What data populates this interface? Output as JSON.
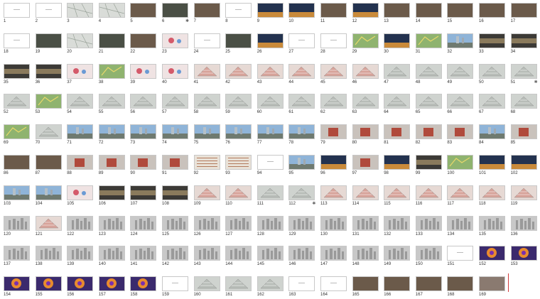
{
  "app": {
    "view": "slide-sorter-thumbnail-grid"
  },
  "slides": [
    {
      "n": "1",
      "v": "blank"
    },
    {
      "n": "2",
      "v": "blank"
    },
    {
      "n": "3",
      "v": "map"
    },
    {
      "n": "4",
      "v": "map"
    },
    {
      "n": "5",
      "v": "photo"
    },
    {
      "n": "6",
      "v": "aerial",
      "star": true
    },
    {
      "n": "7",
      "v": "photo"
    },
    {
      "n": "8",
      "v": "blank"
    },
    {
      "n": "9",
      "v": "night"
    },
    {
      "n": "10",
      "v": "night"
    },
    {
      "n": "11",
      "v": "photo"
    },
    {
      "n": "12",
      "v": "night"
    },
    {
      "n": "13",
      "v": "photo"
    },
    {
      "n": "14",
      "v": "photo"
    },
    {
      "n": "15",
      "v": "photo"
    },
    {
      "n": "16",
      "v": "photo"
    },
    {
      "n": "17",
      "v": "photo"
    },
    {
      "n": "18",
      "v": "blank"
    },
    {
      "n": "19",
      "v": "aerial"
    },
    {
      "n": "20",
      "v": "map"
    },
    {
      "n": "21",
      "v": "aerial"
    },
    {
      "n": "22",
      "v": "photo"
    },
    {
      "n": "23",
      "v": "diagram"
    },
    {
      "n": "24",
      "v": "blank"
    },
    {
      "n": "25",
      "v": "aerial"
    },
    {
      "n": "26",
      "v": "night"
    },
    {
      "n": "27",
      "v": "blank"
    },
    {
      "n": "28",
      "v": "blank"
    },
    {
      "n": "29",
      "v": "greenmap"
    },
    {
      "n": "30",
      "v": "night"
    },
    {
      "n": "31",
      "v": "greenmap"
    },
    {
      "n": "32",
      "v": "sky"
    },
    {
      "n": "33",
      "v": "strip"
    },
    {
      "n": "34",
      "v": "strip"
    },
    {
      "n": "35",
      "v": "strip"
    },
    {
      "n": "36",
      "v": "strip"
    },
    {
      "n": "37",
      "v": "diagram"
    },
    {
      "n": "38",
      "v": "greenmap"
    },
    {
      "n": "39",
      "v": "diagram"
    },
    {
      "n": "40",
      "v": "diagram"
    },
    {
      "n": "41",
      "v": "plan"
    },
    {
      "n": "42",
      "v": "plan"
    },
    {
      "n": "43",
      "v": "plan"
    },
    {
      "n": "44",
      "v": "plan"
    },
    {
      "n": "45",
      "v": "plan"
    },
    {
      "n": "46",
      "v": "plan"
    },
    {
      "n": "47",
      "v": "model"
    },
    {
      "n": "48",
      "v": "model"
    },
    {
      "n": "49",
      "v": "model"
    },
    {
      "n": "50",
      "v": "model"
    },
    {
      "n": "51",
      "v": "model",
      "star": true
    },
    {
      "n": "52",
      "v": "model"
    },
    {
      "n": "53",
      "v": "greenmap"
    },
    {
      "n": "54",
      "v": "model"
    },
    {
      "n": "55",
      "v": "model"
    },
    {
      "n": "56",
      "v": "model"
    },
    {
      "n": "57",
      "v": "model"
    },
    {
      "n": "58",
      "v": "model"
    },
    {
      "n": "59",
      "v": "model"
    },
    {
      "n": "60",
      "v": "model"
    },
    {
      "n": "61",
      "v": "model"
    },
    {
      "n": "62",
      "v": "model"
    },
    {
      "n": "63",
      "v": "model"
    },
    {
      "n": "64",
      "v": "model"
    },
    {
      "n": "65",
      "v": "model"
    },
    {
      "n": "66",
      "v": "model"
    },
    {
      "n": "67",
      "v": "model"
    },
    {
      "n": "68",
      "v": "model"
    },
    {
      "n": "69",
      "v": "greenmap"
    },
    {
      "n": "70",
      "v": "model"
    },
    {
      "n": "71",
      "v": "sky"
    },
    {
      "n": "72",
      "v": "sky"
    },
    {
      "n": "73",
      "v": "sky"
    },
    {
      "n": "74",
      "v": "sky"
    },
    {
      "n": "75",
      "v": "sky"
    },
    {
      "n": "76",
      "v": "sky"
    },
    {
      "n": "77",
      "v": "sky"
    },
    {
      "n": "78",
      "v": "sky"
    },
    {
      "n": "79",
      "v": "render"
    },
    {
      "n": "80",
      "v": "render"
    },
    {
      "n": "81",
      "v": "render"
    },
    {
      "n": "82",
      "v": "render"
    },
    {
      "n": "83",
      "v": "render"
    },
    {
      "n": "84",
      "v": "sky"
    },
    {
      "n": "85",
      "v": "render"
    },
    {
      "n": "86",
      "v": "photo"
    },
    {
      "n": "87",
      "v": "photo"
    },
    {
      "n": "88",
      "v": "render"
    },
    {
      "n": "89",
      "v": "render"
    },
    {
      "n": "90",
      "v": "render"
    },
    {
      "n": "91",
      "v": "render"
    },
    {
      "n": "92",
      "v": "table"
    },
    {
      "n": "93",
      "v": "table"
    },
    {
      "n": "94",
      "v": "blank"
    },
    {
      "n": "95",
      "v": "sky"
    },
    {
      "n": "96",
      "v": "night"
    },
    {
      "n": "97",
      "v": "render"
    },
    {
      "n": "98",
      "v": "night"
    },
    {
      "n": "99",
      "v": "strip"
    },
    {
      "n": "100",
      "v": "greenmap"
    },
    {
      "n": "101",
      "v": "night"
    },
    {
      "n": "102",
      "v": "night"
    },
    {
      "n": "103",
      "v": "sky"
    },
    {
      "n": "104",
      "v": "sky"
    },
    {
      "n": "105",
      "v": "diagram"
    },
    {
      "n": "106",
      "v": "strip"
    },
    {
      "n": "107",
      "v": "strip"
    },
    {
      "n": "108",
      "v": "strip"
    },
    {
      "n": "109",
      "v": "plan"
    },
    {
      "n": "110",
      "v": "plan"
    },
    {
      "n": "111",
      "v": "model"
    },
    {
      "n": "112",
      "v": "model",
      "star": true
    },
    {
      "n": "113",
      "v": "plan"
    },
    {
      "n": "114",
      "v": "plan"
    },
    {
      "n": "115",
      "v": "plan"
    },
    {
      "n": "116",
      "v": "plan"
    },
    {
      "n": "117",
      "v": "plan"
    },
    {
      "n": "118",
      "v": "plan"
    },
    {
      "n": "119",
      "v": "plan"
    },
    {
      "n": "120",
      "v": "towers"
    },
    {
      "n": "121",
      "v": "plan"
    },
    {
      "n": "122",
      "v": "towers"
    },
    {
      "n": "123",
      "v": "towers"
    },
    {
      "n": "124",
      "v": "towers"
    },
    {
      "n": "125",
      "v": "towers"
    },
    {
      "n": "126",
      "v": "towers"
    },
    {
      "n": "127",
      "v": "towers"
    },
    {
      "n": "128",
      "v": "towers"
    },
    {
      "n": "129",
      "v": "towers"
    },
    {
      "n": "130",
      "v": "towers"
    },
    {
      "n": "131",
      "v": "towers"
    },
    {
      "n": "132",
      "v": "towers"
    },
    {
      "n": "133",
      "v": "towers"
    },
    {
      "n": "134",
      "v": "towers"
    },
    {
      "n": "135",
      "v": "towers"
    },
    {
      "n": "136",
      "v": "towers"
    },
    {
      "n": "137",
      "v": "towers"
    },
    {
      "n": "138",
      "v": "towers"
    },
    {
      "n": "139",
      "v": "towers"
    },
    {
      "n": "140",
      "v": "towers"
    },
    {
      "n": "141",
      "v": "towers"
    },
    {
      "n": "142",
      "v": "towers"
    },
    {
      "n": "143",
      "v": "towers"
    },
    {
      "n": "144",
      "v": "towers"
    },
    {
      "n": "145",
      "v": "towers"
    },
    {
      "n": "146",
      "v": "towers"
    },
    {
      "n": "147",
      "v": "towers"
    },
    {
      "n": "148",
      "v": "towers"
    },
    {
      "n": "149",
      "v": "towers"
    },
    {
      "n": "150",
      "v": "towers"
    },
    {
      "n": "151",
      "v": "blank"
    },
    {
      "n": "152",
      "v": "heat"
    },
    {
      "n": "153",
      "v": "heat"
    },
    {
      "n": "154",
      "v": "heat"
    },
    {
      "n": "155",
      "v": "heat"
    },
    {
      "n": "156",
      "v": "heat"
    },
    {
      "n": "157",
      "v": "heat"
    },
    {
      "n": "158",
      "v": "heat"
    },
    {
      "n": "159",
      "v": "blank"
    },
    {
      "n": "160",
      "v": "model"
    },
    {
      "n": "161",
      "v": "model"
    },
    {
      "n": "162",
      "v": "model"
    },
    {
      "n": "163",
      "v": "blank"
    },
    {
      "n": "164",
      "v": "blank"
    },
    {
      "n": "165",
      "v": "photo"
    },
    {
      "n": "166",
      "v": "photo"
    },
    {
      "n": "167",
      "v": "photo"
    },
    {
      "n": "168",
      "v": "photo"
    },
    {
      "n": "169",
      "v": "gray"
    }
  ],
  "colors": {
    "blank": "#ffffff",
    "map": "#d9dcd8",
    "photo": "#6b5a4a",
    "aerial": "#4a4f45",
    "night": "#23324f",
    "diagram": "#efe3e3",
    "greenmap": "#8fb36f",
    "sky": "#8fb4d8",
    "strip": "#3c3a36",
    "plan": "#e6d9d4",
    "model": "#cfd3cf",
    "render": "#c9c2bc",
    "table": "#e9e2d8",
    "towers": "#c8c8c8",
    "heat": "#3b2a6d",
    "gray": "#8a7a70"
  }
}
